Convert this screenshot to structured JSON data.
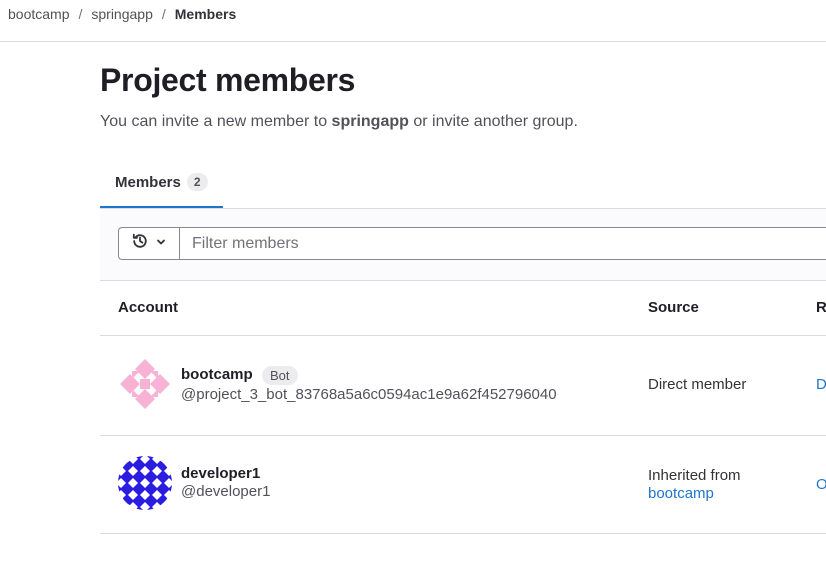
{
  "breadcrumb": {
    "items": [
      "bootcamp",
      "springapp"
    ],
    "separator": "/",
    "current": "Members"
  },
  "page": {
    "title": "Project members",
    "subtitle_prefix": "You can invite a new member to ",
    "subtitle_project": "springapp",
    "subtitle_suffix": " or invite another group."
  },
  "tabs": [
    {
      "label": "Members",
      "count": "2"
    }
  ],
  "filter": {
    "placeholder": "Filter members",
    "history_icon": "history-icon",
    "dropdown_icon": "chevron-down-icon"
  },
  "table": {
    "headers": {
      "account": "Account",
      "source": "Source",
      "role_partial": "R"
    },
    "rows": [
      {
        "name": "bootcamp",
        "badge": "Bot",
        "handle": "@project_3_bot_83768a5a6c0594ac1e9a62f452796040",
        "source": "Direct member",
        "role_partial": "D"
      },
      {
        "name": "developer1",
        "handle": "@developer1",
        "source_prefix": "Inherited from",
        "source_link": "bootcamp",
        "role_partial": "O"
      }
    ]
  },
  "colors": {
    "accent": "#1f75cb",
    "avatar1": "#f7b2d6",
    "avatar2": "#2a1de0"
  }
}
